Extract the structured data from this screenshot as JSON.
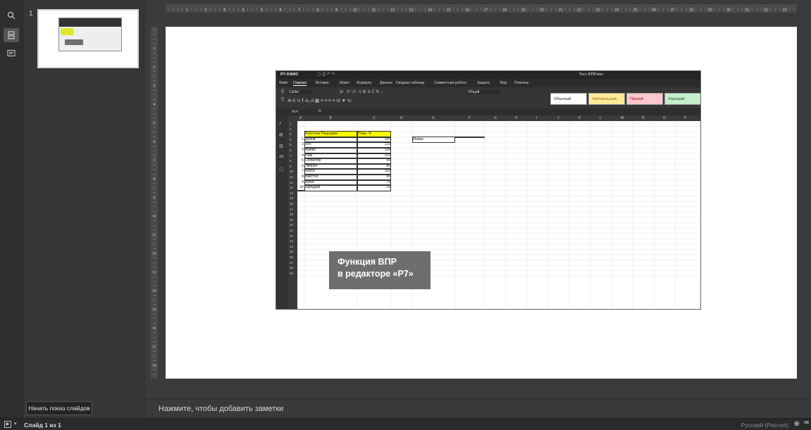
{
  "thumbnail": {
    "slide_number": "1"
  },
  "panel": {
    "start_show_label": "Начать показ слайдов"
  },
  "notes": {
    "placeholder": "Нажмите, чтобы добавить заметки"
  },
  "statusbar": {
    "slide_info": "Слайд 1 из 1",
    "language": "Русский (Россия)"
  },
  "spreadsheet": {
    "brand": "Р7-ОФИС",
    "doc_title": "Тест ВПР.xlsx",
    "menu": [
      "Файл",
      "Главная",
      "Вставка",
      "Макет",
      "Формула",
      "Данные",
      "Сводная таблица",
      "Совместная работа",
      "Защита",
      "Вид",
      "Плагины"
    ],
    "font_name": "Calibri",
    "font_size": "11",
    "number_format": "Общий",
    "styles": [
      {
        "label": "Обычный",
        "bg": "#ffffff",
        "fg": "#222222"
      },
      {
        "label": "Нейтральный",
        "bg": "#ffeb9c",
        "fg": "#9c6500"
      },
      {
        "label": "Плохой",
        "bg": "#ffc7ce",
        "fg": "#9c0006"
      },
      {
        "label": "Хороший",
        "bg": "#c6efce",
        "fg": "#006100"
      }
    ],
    "cell_ref": "A14",
    "fx": "fx",
    "columns": [
      "A",
      "B",
      "C",
      "D",
      "E",
      "F",
      "G",
      "H",
      "I",
      "J",
      "K",
      "L",
      "M",
      "N",
      "O",
      "P"
    ],
    "row_count": 29,
    "header": {
      "name": "Работник Пиццерии",
      "plan": "План, %"
    },
    "rows": [
      {
        "n": "1",
        "name": "Донни",
        "plan": "100"
      },
      {
        "n": "2",
        "name": "Лео",
        "plan": "133"
      },
      {
        "n": "3",
        "name": "Майки",
        "plan": "108"
      },
      {
        "n": "4",
        "name": "Раф",
        "plan": "102"
      },
      {
        "n": "5",
        "name": "Сплинтер",
        "plan": "99"
      },
      {
        "n": "6",
        "name": "Эйприл",
        "plan": "80"
      },
      {
        "n": "7",
        "name": "Кейси",
        "plan": "110"
      },
      {
        "n": "8",
        "name": "Бакстер",
        "plan": "95"
      },
      {
        "n": "9",
        "name": "Кранг",
        "plan": "75"
      },
      {
        "n": "10",
        "name": "Шреддер",
        "plan": "10"
      }
    ],
    "lookup_value": "Майки",
    "overlay": {
      "line1": "Функция ВПР",
      "line2": "в редакторе «Р7»"
    },
    "header_color": "#ffff00"
  },
  "ruler": {
    "h_labels": [
      "1",
      "2",
      "3",
      "4",
      "5",
      "6",
      "7",
      "8",
      "9",
      "10",
      "11",
      "12",
      "13",
      "14",
      "15",
      "16",
      "17",
      "18",
      "19",
      "20",
      "21",
      "22",
      "23",
      "24",
      "25",
      "26",
      "27",
      "28",
      "29",
      "30",
      "31",
      "32",
      "33"
    ],
    "v_labels": [
      "1",
      "2",
      "3",
      "4",
      "5",
      "6",
      "7",
      "8",
      "9",
      "10",
      "11",
      "12",
      "13",
      "14",
      "15",
      "16",
      "17",
      "18"
    ]
  }
}
